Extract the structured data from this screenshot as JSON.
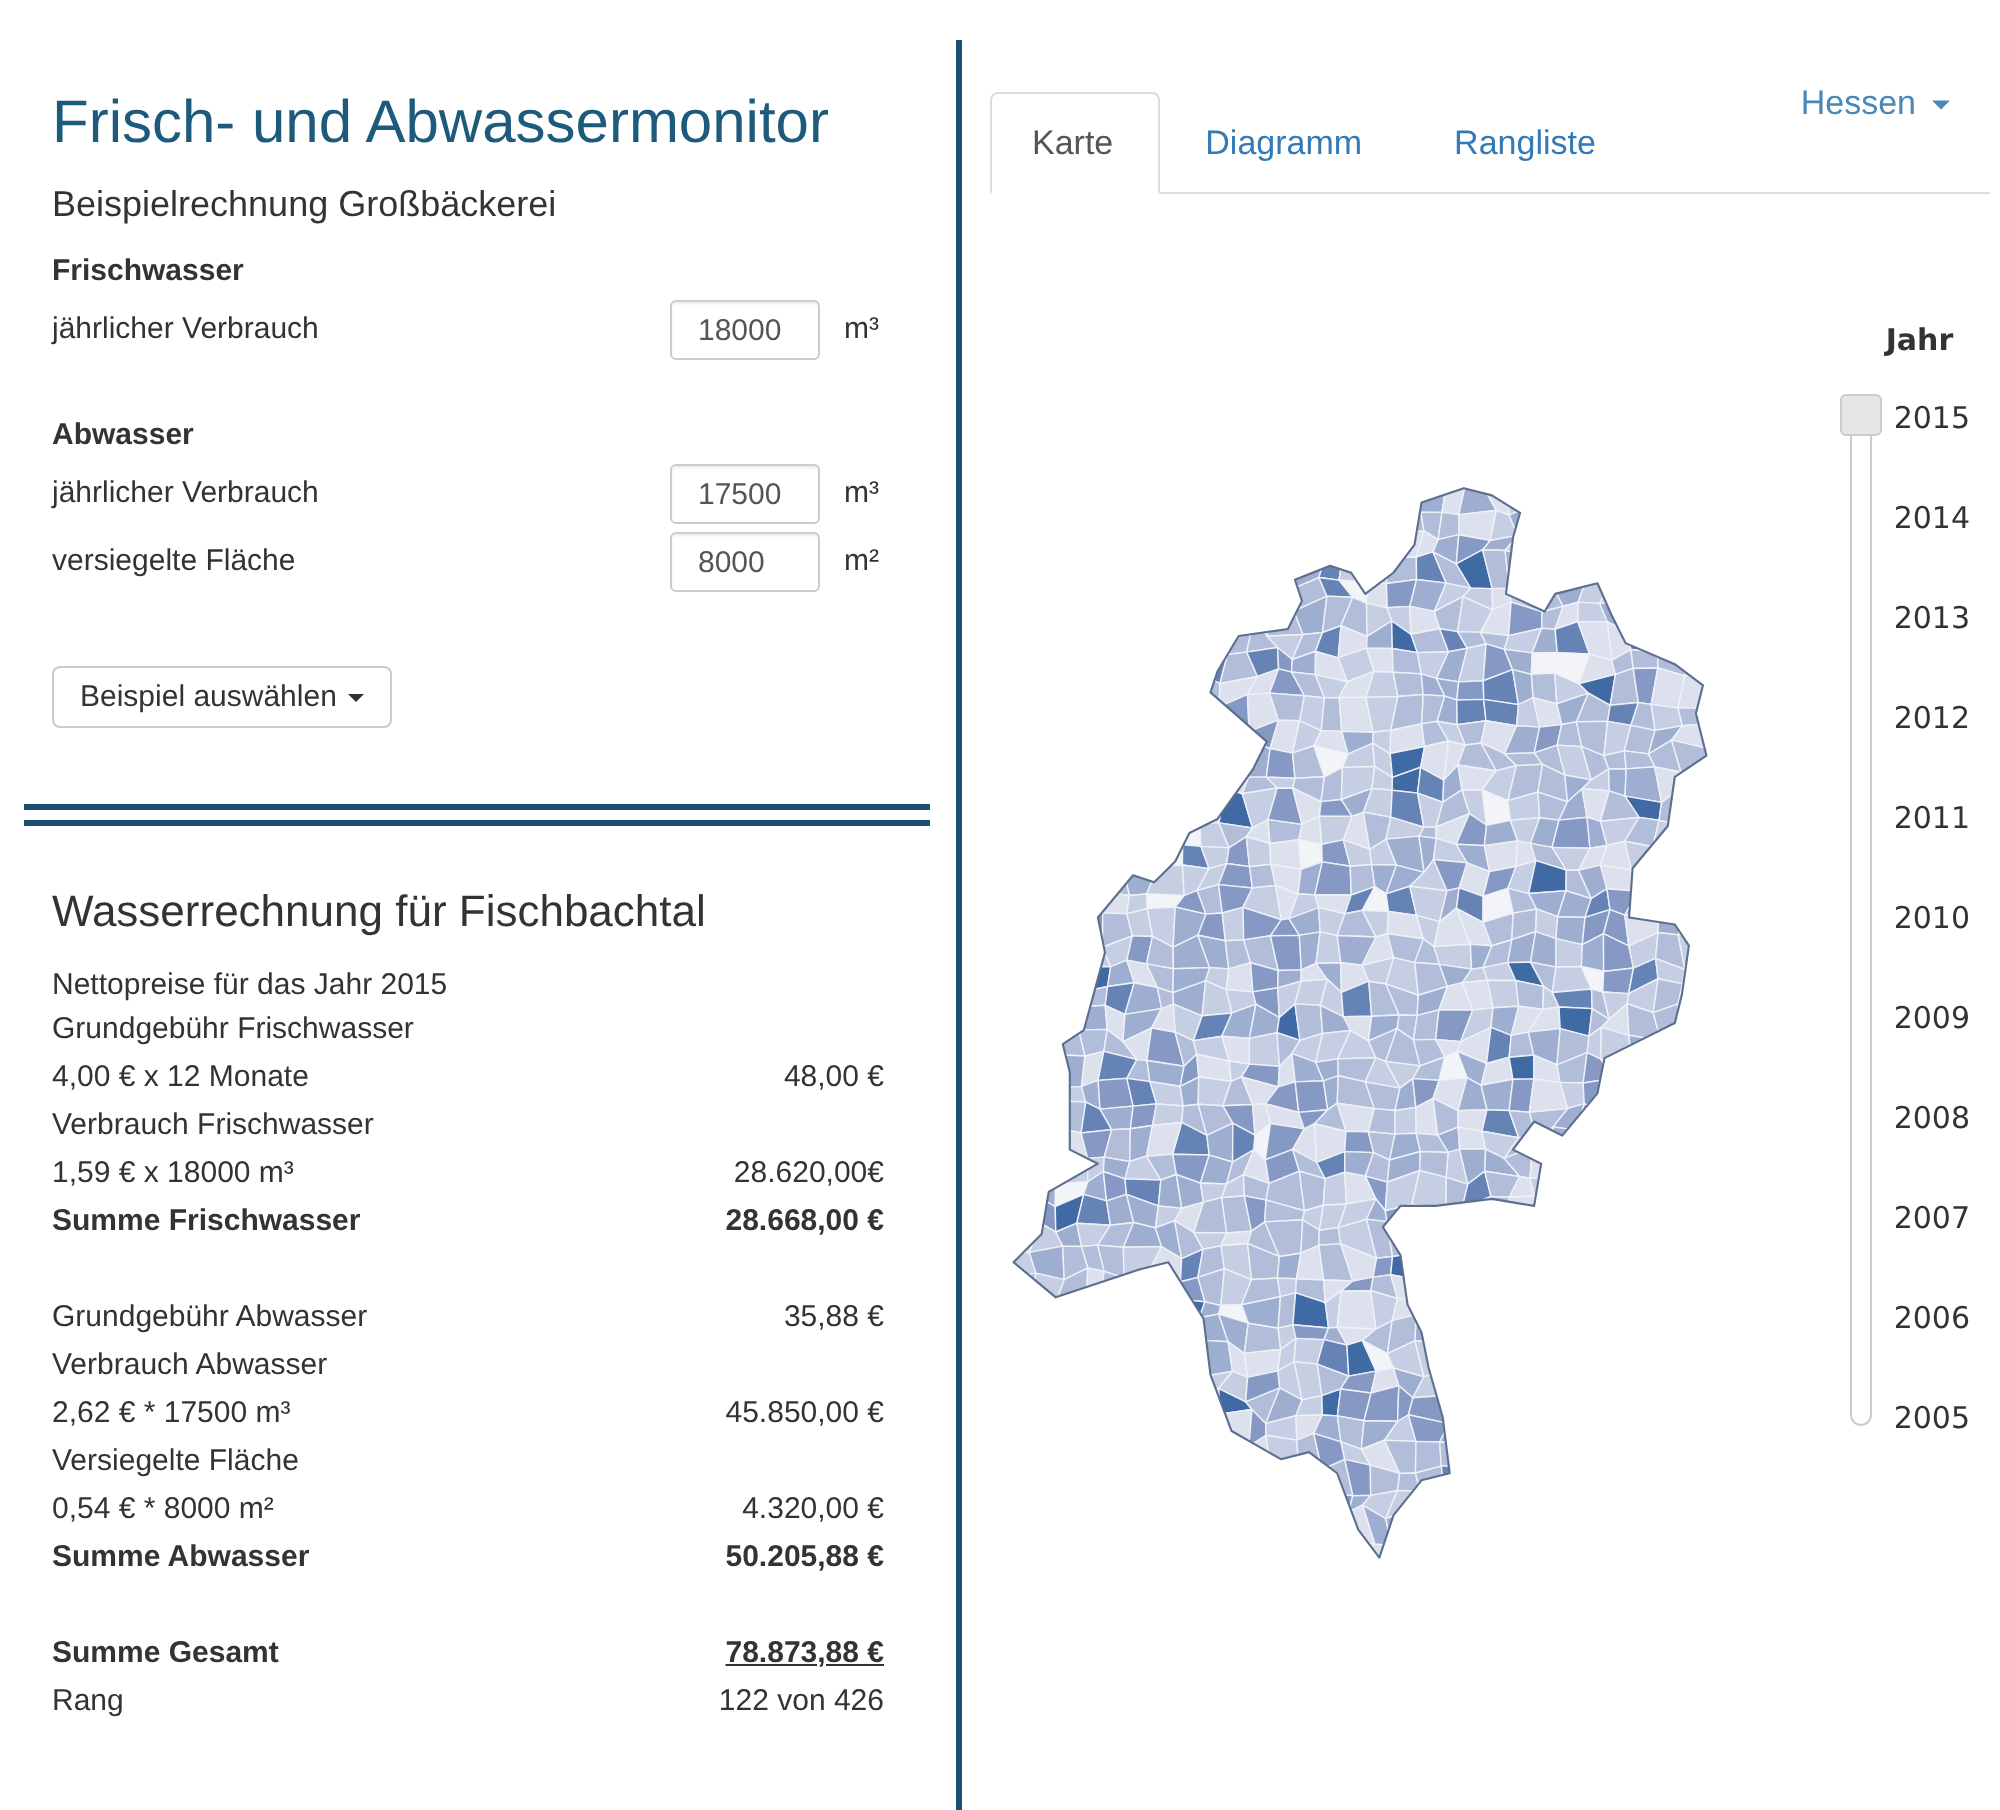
{
  "header": {
    "title": "Frisch- und Abwassermonitor",
    "subtitle": "Beispielrechnung Großbäckerei"
  },
  "input_sections": [
    {
      "heading": "Frischwasser",
      "fields": [
        {
          "label": "jährlicher Verbrauch",
          "value": "18000",
          "unit": "m³"
        }
      ]
    },
    {
      "heading": "Abwasser",
      "fields": [
        {
          "label": "jährlicher Verbrauch",
          "value": "17500",
          "unit": "m³"
        },
        {
          "label": "versiegelte Fläche",
          "value": "8000",
          "unit": "m²"
        }
      ]
    }
  ],
  "example_button": {
    "label": "Beispiel auswählen"
  },
  "calculation": {
    "title": "Wasserrechnung für Fischbachtal",
    "note": "Nettopreise für das Jahr 2015",
    "groups": [
      {
        "rows": [
          {
            "kind": "line",
            "label": "Grundgebühr Frischwasser"
          },
          {
            "kind": "line",
            "label": "4,00 € x 12 Monate",
            "amount": "48,00 €"
          },
          {
            "kind": "line",
            "label": "Verbrauch Frischwasser"
          },
          {
            "kind": "line",
            "label": "1,59 € x 18000 m³",
            "amount": "28.620,00€"
          },
          {
            "kind": "sum",
            "label": "Summe Frischwasser",
            "amount": "28.668,00 €"
          }
        ]
      },
      {
        "rows": [
          {
            "kind": "line",
            "label": "Grundgebühr Abwasser",
            "amount": "35,88 €"
          },
          {
            "kind": "line",
            "label": "Verbrauch Abwasser"
          },
          {
            "kind": "line",
            "label": "2,62 € * 17500 m³",
            "amount": "45.850,00 €"
          },
          {
            "kind": "line",
            "label": "Versiegelte Fläche"
          },
          {
            "kind": "line",
            "label": "0,54 € * 8000 m²",
            "amount": "4.320,00 €"
          },
          {
            "kind": "sum",
            "label": "Summe Abwasser",
            "amount": "50.205,88 €"
          }
        ]
      },
      {
        "rows": [
          {
            "kind": "total",
            "label": "Summe Gesamt",
            "amount": "78.873,88 €"
          },
          {
            "kind": "line",
            "label": "Rang",
            "amount": "122 von 426"
          }
        ]
      }
    ]
  },
  "tabs": [
    {
      "label": "Karte",
      "selected": true
    },
    {
      "label": "Diagramm",
      "selected": false
    },
    {
      "label": "Rangliste",
      "selected": false
    }
  ],
  "region_dropdown": {
    "label": "Hessen"
  },
  "year_slider": {
    "title": "Jahr",
    "level": 1,
    "years": [
      "2015",
      "2014",
      "2013",
      "2012",
      "2011",
      "2010",
      "2009",
      "2008",
      "2007",
      "2006",
      "2005"
    ]
  }
}
